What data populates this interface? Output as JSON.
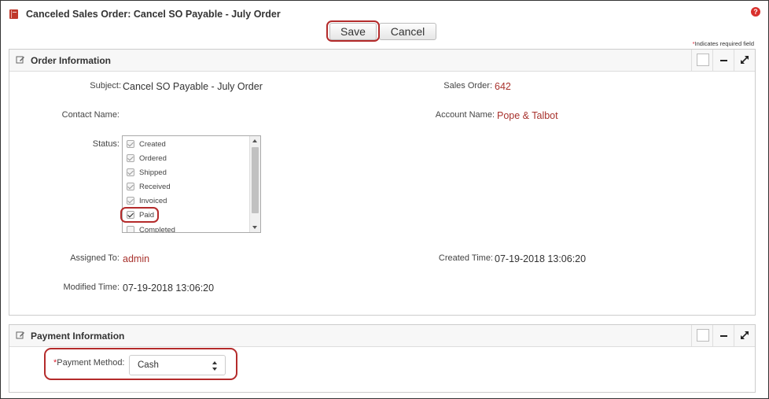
{
  "header": {
    "title": "Canceled Sales Order: Cancel SO Payable - July Order",
    "help": "?",
    "save_label": "Save",
    "cancel_label": "Cancel",
    "required_star": "*",
    "required_note": "Indicates required field"
  },
  "order_panel": {
    "title": "Order Information",
    "subject_label": "Subject:",
    "subject_value": "Cancel SO Payable - July Order",
    "sales_order_label": "Sales Order:",
    "sales_order_value": "642",
    "contact_label": "Contact Name:",
    "account_label": "Account Name:",
    "account_value": "Pope & Talbot",
    "status_label": "Status:",
    "status_items": [
      {
        "label": "Created",
        "checked": true
      },
      {
        "label": "Ordered",
        "checked": true
      },
      {
        "label": "Shipped",
        "checked": true
      },
      {
        "label": "Received",
        "checked": true
      },
      {
        "label": "Invoiced",
        "checked": true
      },
      {
        "label": "Paid",
        "checked": true
      },
      {
        "label": "Completed",
        "checked": false
      }
    ],
    "assigned_label": "Assigned To:",
    "assigned_value": "admin",
    "created_label": "Created Time:",
    "created_value": "07-19-2018 13:06:20",
    "modified_label": "Modified Time:",
    "modified_value": "07-19-2018 13:06:20"
  },
  "payment_panel": {
    "title": "Payment Information",
    "method_star": "*",
    "method_label": "Payment Method:",
    "method_value": "Cash"
  },
  "colors": {
    "accent_link": "#a8322d",
    "highlight": "#b42b2b",
    "required": "#d23"
  }
}
